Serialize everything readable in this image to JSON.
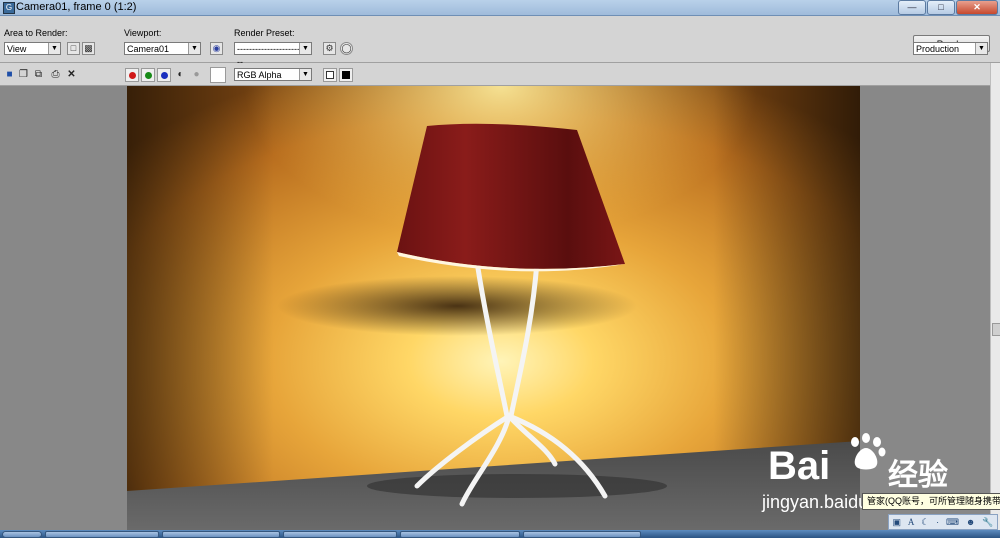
{
  "window": {
    "title": "Camera01, frame 0 (1:2)",
    "controls": [
      "minimize-icon",
      "maximize-icon",
      "close-icon"
    ]
  },
  "toolbar": {
    "area_to_render_label": "Area to Render:",
    "area_to_render_value": "View",
    "viewport_label": "Viewport:",
    "viewport_value": "Camera01",
    "render_preset_label": "Render Preset:",
    "render_preset_value": "--------------------------",
    "render_button": "Render",
    "production_value": "Production"
  },
  "toolbar2": {
    "icons": [
      "save-icon",
      "clone-icon",
      "print-icon",
      "clear-icon"
    ],
    "channels": [
      {
        "name": "red-channel",
        "color": "#d01818"
      },
      {
        "name": "green-channel",
        "color": "#178a17"
      },
      {
        "name": "blue-channel",
        "color": "#1a2fbf"
      }
    ],
    "channel_display_value": "RGB Alpha"
  },
  "render": {
    "wall_color": "#e7a53a",
    "shade_color": "#6b1212",
    "floor_color": "#4a4a4a"
  },
  "watermark": {
    "brand": "Bai",
    "brand_cn": "经验",
    "url": "jingyan.baidu.com"
  },
  "tooltip": {
    "text": "管家(QQ账号，可所管理随身携带)"
  },
  "tray_icons": [
    "q-icon",
    "a-icon",
    "moon-icon",
    "dot-icon",
    "keyboard-icon",
    "user-icon",
    "wrench-icon"
  ]
}
